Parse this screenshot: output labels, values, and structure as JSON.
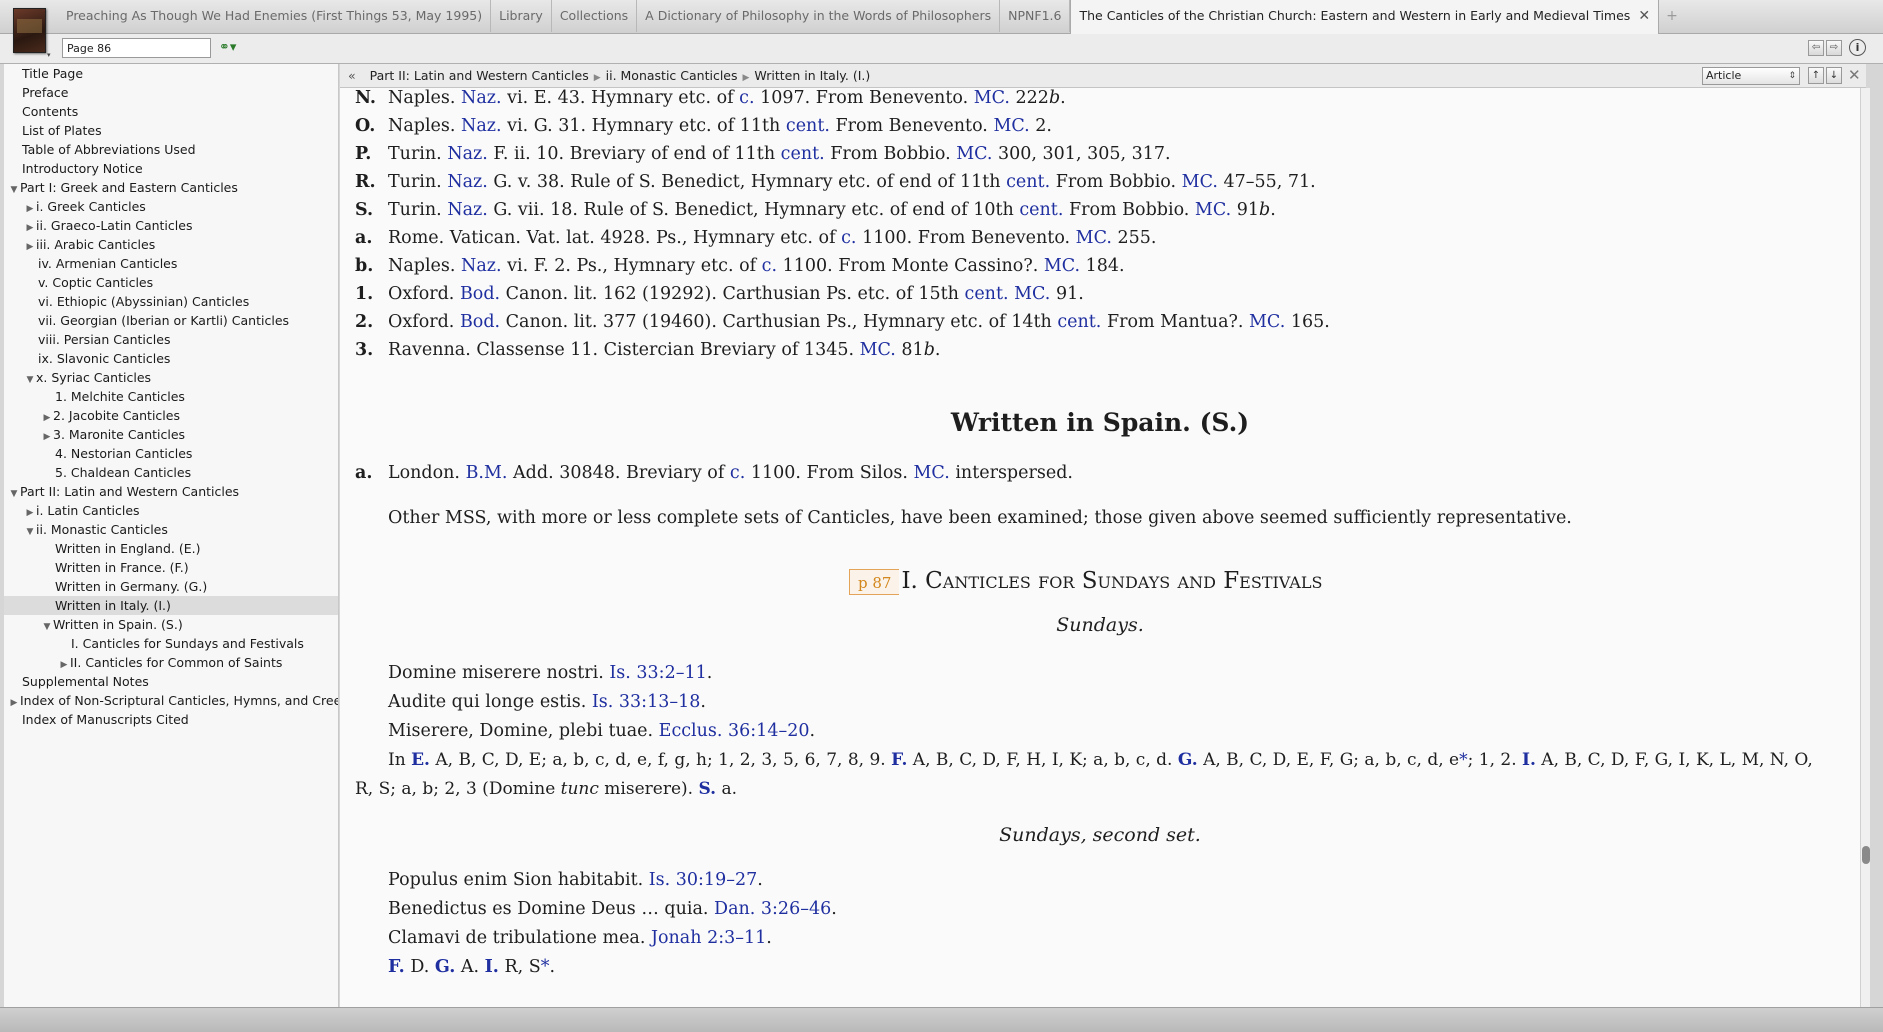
{
  "tabs": [
    {
      "label": "Preaching As Though We Had Enemies  (First Things 53, May 1995)"
    },
    {
      "label": "Library"
    },
    {
      "label": "Collections"
    },
    {
      "label": "A Dictionary of Philosophy in the Words of Philosophers"
    },
    {
      "label": "NPNF1.6"
    },
    {
      "label": "The Canticles of the Christian Church: Eastern and Western in Early and Medieval Times"
    }
  ],
  "toolbar": {
    "page_value": "Page 86"
  },
  "toc": [
    {
      "label": "Title Page"
    },
    {
      "label": "Preface"
    },
    {
      "label": "Contents"
    },
    {
      "label": "List of Plates"
    },
    {
      "label": "Table of Abbreviations Used"
    },
    {
      "label": "Introductory Notice"
    },
    {
      "label": "Part I: Greek and Eastern Canticles"
    },
    {
      "label": "i. Greek Canticles"
    },
    {
      "label": "ii. Graeco-Latin Canticles"
    },
    {
      "label": "iii. Arabic Canticles"
    },
    {
      "label": "iv. Armenian Canticles"
    },
    {
      "label": "v. Coptic Canticles"
    },
    {
      "label": "vi. Ethiopic (Abyssinian) Canticles"
    },
    {
      "label": "vii. Georgian (Iberian or Kartli) Canticles"
    },
    {
      "label": "viii. Persian Canticles"
    },
    {
      "label": "ix. Slavonic Canticles"
    },
    {
      "label": "x. Syriac Canticles"
    },
    {
      "label": "1. Melchite Canticles"
    },
    {
      "label": "2. Jacobite Canticles"
    },
    {
      "label": "3. Maronite Canticles"
    },
    {
      "label": "4. Nestorian Canticles"
    },
    {
      "label": "5. Chaldean Canticles"
    },
    {
      "label": "Part II: Latin and Western Canticles"
    },
    {
      "label": "i. Latin Canticles"
    },
    {
      "label": "ii. Monastic Canticles"
    },
    {
      "label": "Written in England. (E.)"
    },
    {
      "label": "Written in France. (F.)"
    },
    {
      "label": "Written in Germany. (G.)"
    },
    {
      "label": "Written in Italy. (I.)"
    },
    {
      "label": "Written in Spain. (S.)"
    },
    {
      "label": "I. Canticles for Sundays and Festivals"
    },
    {
      "label": "II. Canticles for Common of Saints"
    },
    {
      "label": "Supplemental Notes"
    },
    {
      "label": "Index of Non-Scriptural Canticles, Hymns, and Creeds"
    },
    {
      "label": "Index of Manuscripts Cited"
    }
  ],
  "breadcrumb": [
    "Part II: Latin and Western Canticles",
    "ii. Monastic Canticles",
    "Written in Italy. (I.)"
  ],
  "view_select": "Article",
  "content": {
    "mss": [
      {
        "label": "N.",
        "city": "Naples. ",
        "lib": "Naz.",
        "desc": " vi. E. 43. Hymnary etc. of ",
        "c": "c.",
        "date": " 1097. From Benevento. ",
        "mc": "MC.",
        "end": " 222",
        "endi": "b",
        "tail": "."
      },
      {
        "label": "O.",
        "city": "Naples. ",
        "lib": "Naz.",
        "desc": " vi. G. 31. Hymnary etc. of 11th ",
        "c": "cent.",
        "date": " From Benevento. ",
        "mc": "MC.",
        "end": " 2.",
        "endi": "",
        "tail": ""
      },
      {
        "label": "P.",
        "city": "Turin. ",
        "lib": "Naz.",
        "desc": " F. ii. 10. Breviary of end of 11th ",
        "c": "cent.",
        "date": " From Bobbio. ",
        "mc": "MC.",
        "end": " 300, 301, 305, 317.",
        "endi": "",
        "tail": ""
      },
      {
        "label": "R.",
        "city": "Turin. ",
        "lib": "Naz.",
        "desc": " G. v. 38. Rule of S. Benedict, Hymnary etc. of end of 11th ",
        "c": "cent.",
        "date": " From Bobbio. ",
        "mc": "MC.",
        "end": " 47–55, 71.",
        "endi": "",
        "tail": ""
      },
      {
        "label": "S.",
        "city": "Turin. ",
        "lib": "Naz.",
        "desc": " G. vii. 18. Rule of S. Benedict, Hymnary etc. of end of 10th ",
        "c": "cent.",
        "date": " From Bobbio. ",
        "mc": "MC.",
        "end": " 91",
        "endi": "b",
        "tail": "."
      },
      {
        "label": "a.",
        "city": "Rome. Vatican. Vat. lat. 4928. Ps., Hymnary etc. of ",
        "lib": "",
        "desc": "",
        "c": "c.",
        "date": " 1100. From Benevento. ",
        "mc": "MC.",
        "end": " 255.",
        "endi": "",
        "tail": ""
      },
      {
        "label": "b.",
        "city": "Naples. ",
        "lib": "Naz.",
        "desc": " vi. F. 2. Ps., Hymnary etc. of ",
        "c": "c.",
        "date": " 1100. From Monte Cassino?. ",
        "mc": "MC.",
        "end": " 184.",
        "endi": "",
        "tail": ""
      },
      {
        "label": "1.",
        "city": "Oxford. ",
        "lib": "Bod.",
        "desc": " Canon. lit. 162 (19292). Carthusian Ps. etc. of 15th ",
        "c": "cent.",
        "date": " ",
        "mc": "MC.",
        "end": " 91.",
        "endi": "",
        "tail": ""
      },
      {
        "label": "2.",
        "city": "Oxford. ",
        "lib": "Bod.",
        "desc": " Canon. lit. 377 (19460). Carthusian Ps., Hymnary etc. of 14th ",
        "c": "cent.",
        "date": " From Mantua?. ",
        "mc": "MC.",
        "end": " 165.",
        "endi": "",
        "tail": ""
      },
      {
        "label": "3.",
        "city": "Ravenna. Classense 11. Cistercian Breviary of 1345. ",
        "lib": "",
        "desc": "",
        "c": "",
        "date": "",
        "mc": "MC.",
        "end": " 81",
        "endi": "b",
        "tail": "."
      }
    ],
    "spain_heading": "Written in Spain. (S.)",
    "spain_entry": {
      "label": "a.",
      "city": "London. ",
      "lib": "B.M.",
      "desc": " Add. 30848. Breviary of ",
      "c": "c.",
      "date": " 1100. From Silos. ",
      "mc": "MC.",
      "end": " interspersed."
    },
    "other_mss": "Other MSS, with more or less complete sets of Canticles, have been examined; those given above seemed sufficiently representative.",
    "page_marker": "p 87",
    "chapter_heading": "I. Canticles for Sundays and Festivals",
    "sundays": "Sundays.",
    "sunday_lines": [
      {
        "text": "Domine miserere nostri. ",
        "ref": "Is. 33:2–11",
        "end": "."
      },
      {
        "text": "Audite qui longe estis. ",
        "ref": "Is. 33:13–18",
        "end": "."
      },
      {
        "text": "Miserere, Domine, plebi tuae. ",
        "ref": "Ecclus. 36:14–20",
        "end": "."
      }
    ],
    "in_line_1": {
      "a": "In ",
      "E": "E.",
      "b": " A, B, C, D, E; a, b, c, d, e, f, g, h; 1, 2, 3, 5, 6, 7, 8, 9. ",
      "F": "F.",
      "c": " A, B, C, D, F, H, I, K; a, b, c, d. ",
      "G": "G.",
      "d": " A, B, C, D, E, F, G; a, b, c, d, e",
      "star": "*",
      "e": "; 1, 2. ",
      "I": "I.",
      "f": " A, B, C, D, F, G, I, K, L, M, N, O,"
    },
    "in_line_2": {
      "a": "R, S; a, b; 2, 3 (Domine ",
      "tunc": "tunc",
      "b": " miserere). ",
      "S": "S.",
      "c": " a."
    },
    "sundays_second": "Sundays, second set.",
    "second_lines": [
      {
        "text": "Populus enim Sion habitabit. ",
        "ref": "Is. 30:19–27",
        "end": "."
      },
      {
        "text": "Benedictus es Domine Deus … quia. ",
        "ref": "Dan. 3:26–46",
        "end": "."
      },
      {
        "text": "Clamavi de tribulatione mea. ",
        "ref": "Jonah 2:3–11",
        "end": "."
      }
    ],
    "last_line": {
      "F": "F.",
      "a": " D. ",
      "G": "G.",
      "b": " A. ",
      "I": "I.",
      "c": " R, S",
      "star": "*",
      "d": "."
    }
  }
}
